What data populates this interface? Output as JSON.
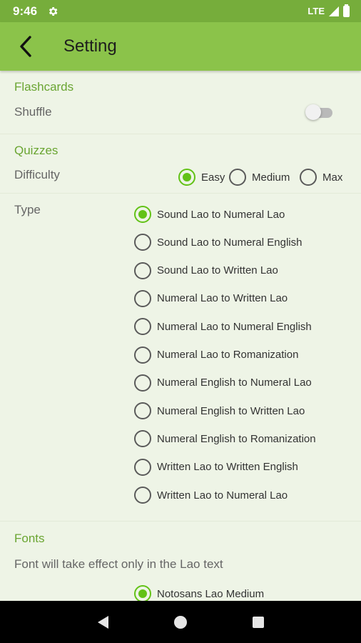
{
  "status_bar": {
    "time": "9:46",
    "network": "LTE"
  },
  "app_bar": {
    "title": "Setting"
  },
  "flashcards": {
    "heading": "Flashcards",
    "shuffle_label": "Shuffle",
    "shuffle_on": false
  },
  "quizzes": {
    "heading": "Quizzes",
    "difficulty_label": "Difficulty",
    "difficulty_options": [
      "Easy",
      "Medium",
      "Max"
    ],
    "difficulty_selected": "Easy",
    "type_label": "Type",
    "type_options": [
      "Sound Lao to Numeral Lao",
      "Sound Lao to Numeral English",
      "Sound Lao to Written Lao",
      "Numeral Lao to Written Lao",
      "Numeral Lao to Numeral English",
      "Numeral Lao to Romanization",
      "Numeral English to Numeral Lao",
      "Numeral English to Written Lao",
      "Numeral English to Romanization",
      "Written Lao to Written English",
      "Written Lao to Numeral Lao"
    ],
    "type_selected": "Sound Lao to Numeral Lao"
  },
  "fonts": {
    "heading": "Fonts",
    "note": "Font will take effect only in the Lao text",
    "options": [
      "Notosans Lao Medium"
    ],
    "selected": "Notosans Lao Medium"
  },
  "colors": {
    "primary": "#8bc34a",
    "primary_dark": "#76ad3b",
    "accent": "#62c216",
    "heading": "#6aa532",
    "background": "#eef4e6"
  },
  "icons": {
    "back": "arrow-back-icon",
    "settings": "gear-icon",
    "nav_back": "triangle-back-icon",
    "nav_home": "circle-home-icon",
    "nav_recents": "square-recents-icon"
  }
}
